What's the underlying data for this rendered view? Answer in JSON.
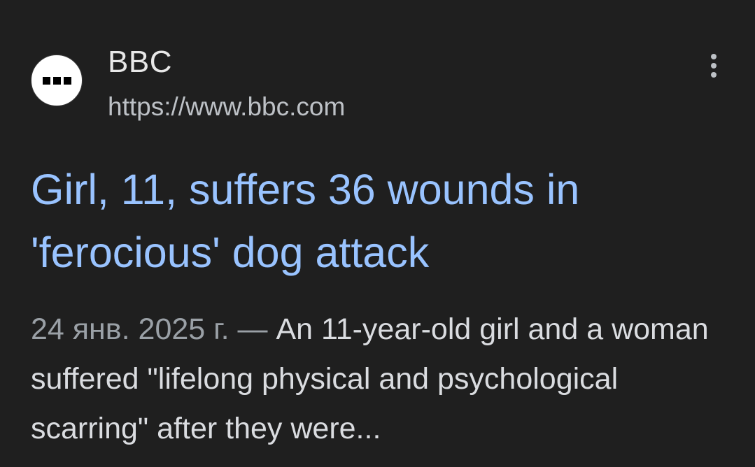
{
  "source": {
    "favicon_icon": "bbc-logo-icon",
    "name": "BBC",
    "url": "https://www.bbc.com"
  },
  "menu": {
    "icon": "more-vert-icon"
  },
  "result": {
    "title": "Girl, 11, suffers 36 wounds in 'ferocious' dog attack",
    "date": "24 янв. 2025 г.",
    "separator": " — ",
    "snippet": "An 11-year-old girl and a woman suffered \"lifelong physical and psychological scarring\" after they were..."
  },
  "colors": {
    "background": "#1f1f1f",
    "title_link": "#99c3ff",
    "site_name": "#e8e8e8",
    "url": "#bdc1c6",
    "date": "#9aa0a6",
    "snippet": "#dadce0"
  }
}
